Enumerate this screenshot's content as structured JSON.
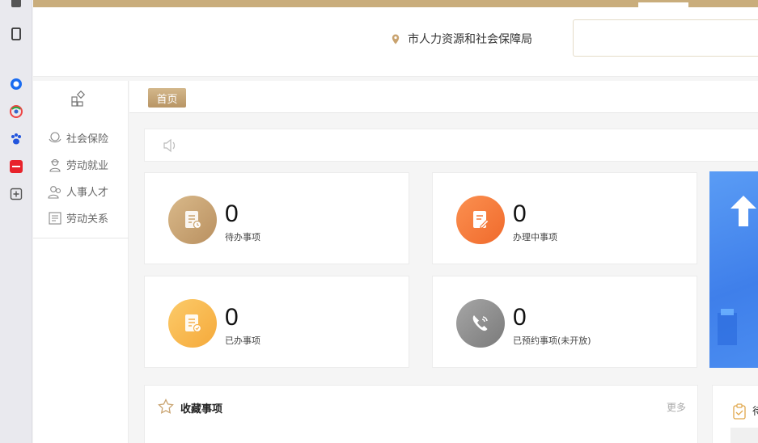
{
  "header": {
    "location": "市人力资源和社会保障局"
  },
  "side_menu": {
    "items": [
      {
        "label": "社会保险",
        "icon": "social-insurance-icon"
      },
      {
        "label": "劳动就业",
        "icon": "employment-icon"
      },
      {
        "label": "人事人才",
        "icon": "talent-icon"
      },
      {
        "label": "劳动关系",
        "icon": "labor-relations-icon"
      }
    ]
  },
  "tabs": {
    "home": "首页"
  },
  "cards": [
    {
      "count": "0",
      "label": "待办事项",
      "color": "#c9a36f"
    },
    {
      "count": "0",
      "label": "办理中事项",
      "color": "#f47a3b"
    },
    {
      "count": "0",
      "label": "已办事项",
      "color": "#f9b84a"
    },
    {
      "count": "0",
      "label": "已预约事项(未开放)",
      "color": "#8c8c8c"
    }
  ],
  "favorites": {
    "title": "收藏事项",
    "more": "更多"
  },
  "right_panel": {
    "title": "待"
  },
  "colors": {
    "accent": "#c9ad7c",
    "banner": "#4a8cf0"
  }
}
